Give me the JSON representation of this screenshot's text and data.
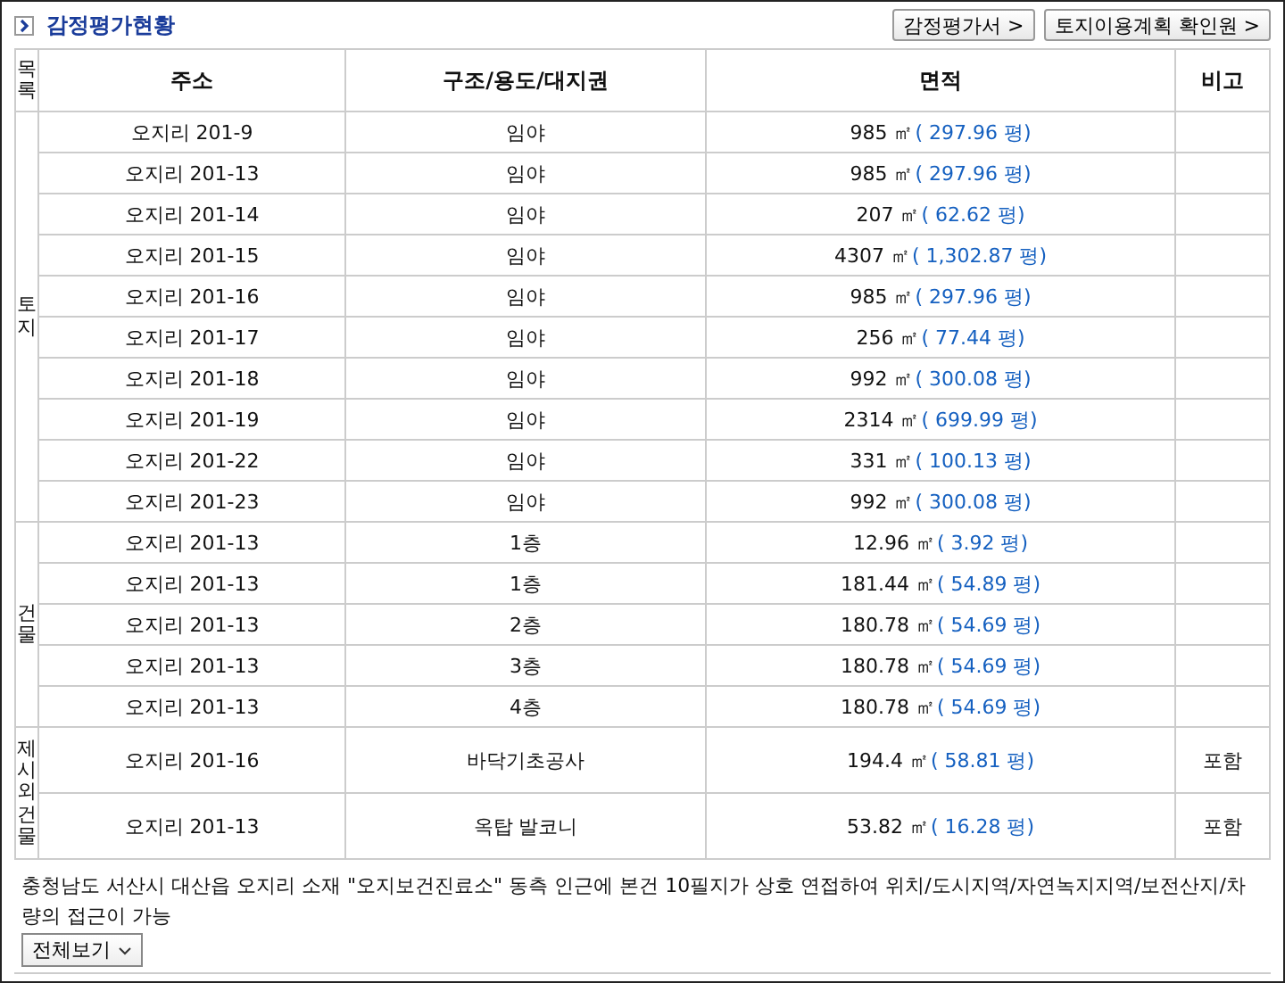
{
  "section": {
    "title": "감정평가현황",
    "buttons": [
      {
        "label": "감정평가서 >"
      },
      {
        "label": "토지이용계획 확인원 >"
      }
    ]
  },
  "table": {
    "columns": [
      "목록",
      "주소",
      "구조/용도/대지권",
      "면적",
      "비고"
    ],
    "groups": [
      {
        "label": "토지",
        "rows": [
          {
            "address": "오지리 201-9",
            "structure": "임야",
            "area": "985 ㎡",
            "pyeong": "( 297.96 평)",
            "note": ""
          },
          {
            "address": "오지리 201-13",
            "structure": "임야",
            "area": "985 ㎡",
            "pyeong": "( 297.96 평)",
            "note": ""
          },
          {
            "address": "오지리 201-14",
            "structure": "임야",
            "area": "207 ㎡",
            "pyeong": "( 62.62 평)",
            "note": ""
          },
          {
            "address": "오지리 201-15",
            "structure": "임야",
            "area": "4307 ㎡",
            "pyeong": "( 1,302.87 평)",
            "note": ""
          },
          {
            "address": "오지리 201-16",
            "structure": "임야",
            "area": "985 ㎡",
            "pyeong": "( 297.96 평)",
            "note": ""
          },
          {
            "address": "오지리 201-17",
            "structure": "임야",
            "area": "256 ㎡",
            "pyeong": "( 77.44 평)",
            "note": ""
          },
          {
            "address": "오지리 201-18",
            "structure": "임야",
            "area": "992 ㎡",
            "pyeong": "( 300.08 평)",
            "note": ""
          },
          {
            "address": "오지리 201-19",
            "structure": "임야",
            "area": "2314 ㎡",
            "pyeong": "( 699.99 평)",
            "note": ""
          },
          {
            "address": "오지리 201-22",
            "structure": "임야",
            "area": "331 ㎡",
            "pyeong": "( 100.13 평)",
            "note": ""
          },
          {
            "address": "오지리 201-23",
            "structure": "임야",
            "area": "992 ㎡",
            "pyeong": "( 300.08 평)",
            "note": ""
          }
        ]
      },
      {
        "label": "건물",
        "rows": [
          {
            "address": "오지리 201-13",
            "structure": "1층",
            "area": "12.96 ㎡",
            "pyeong": "( 3.92 평)",
            "note": ""
          },
          {
            "address": "오지리 201-13",
            "structure": "1층",
            "area": "181.44 ㎡",
            "pyeong": "( 54.89 평)",
            "note": ""
          },
          {
            "address": "오지리 201-13",
            "structure": "2층",
            "area": "180.78 ㎡",
            "pyeong": "( 54.69 평)",
            "note": ""
          },
          {
            "address": "오지리 201-13",
            "structure": "3층",
            "area": "180.78 ㎡",
            "pyeong": "( 54.69 평)",
            "note": ""
          },
          {
            "address": "오지리 201-13",
            "structure": "4층",
            "area": "180.78 ㎡",
            "pyeong": "( 54.69 평)",
            "note": ""
          }
        ]
      },
      {
        "label": "제시외건물",
        "rows": [
          {
            "address": "오지리 201-16",
            "structure": "바닥기초공사",
            "area": "194.4 ㎡",
            "pyeong": "( 58.81 평)",
            "note": "포함"
          },
          {
            "address": "오지리 201-13",
            "structure": "옥탑 발코니",
            "area": "53.82 ㎡",
            "pyeong": "( 16.28 평)",
            "note": "포함"
          }
        ]
      }
    ]
  },
  "description": "충청남도 서산시 대산읍 오지리 소재 \"오지보건진료소\" 동측 인근에 본건 10필지가 상호 연접하여 위치/도시지역/자연녹지지역/보전산지/차량의 접근이 가능",
  "expand_button": {
    "label": "전체보기"
  }
}
